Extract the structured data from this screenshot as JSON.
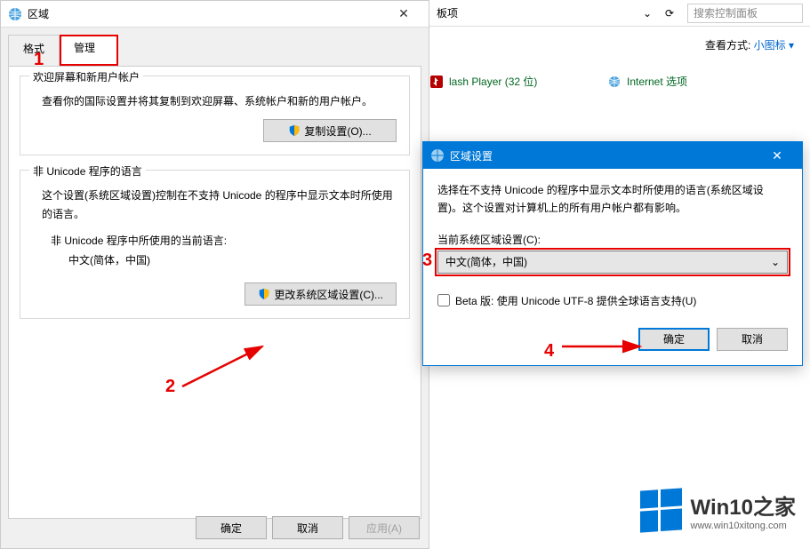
{
  "regionDialog": {
    "title": "区域",
    "tabs": {
      "format": "格式",
      "admin": "管理"
    },
    "group1": {
      "legend": "欢迎屏幕和新用户帐户",
      "desc": "查看你的国际设置并将其复制到欢迎屏幕、系统帐户和新的用户帐户。",
      "button": "复制设置(O)..."
    },
    "group2": {
      "legend": "非 Unicode 程序的语言",
      "desc": "这个设置(系统区域设置)控制在不支持 Unicode 的程序中显示文本时所使用的语言。",
      "currentLabel": "非 Unicode 程序中所使用的当前语言:",
      "currentValue": "中文(简体，中国)",
      "button": "更改系统区域设置(C)..."
    },
    "buttons": {
      "ok": "确定",
      "cancel": "取消",
      "apply": "应用(A)"
    }
  },
  "controlPanel": {
    "breadcrumb": "板项",
    "dropdownChevron": "⌄",
    "refresh": "⟳",
    "searchPlaceholder": "搜索控制面板",
    "viewLabel": "查看方式:",
    "viewValue": "小图标 ▾",
    "items": {
      "flash": "lash Player (32 位)",
      "internet": "Internet 选项"
    }
  },
  "localeDialog": {
    "title": "区域设置",
    "desc": "选择在不支持 Unicode 的程序中显示文本时所使用的语言(系统区域设置)。这个设置对计算机上的所有用户帐户都有影响。",
    "selectLabel": "当前系统区域设置(C):",
    "selectValue": "中文(简体，中国)",
    "checkboxLabel": "Beta 版: 使用 Unicode UTF-8 提供全球语言支持(U)",
    "ok": "确定",
    "cancel": "取消"
  },
  "annotations": {
    "n1": "1",
    "n2": "2",
    "n3": "3",
    "n4": "4"
  },
  "watermark": {
    "brand": "Win10之家",
    "url": "www.win10xitong.com"
  }
}
